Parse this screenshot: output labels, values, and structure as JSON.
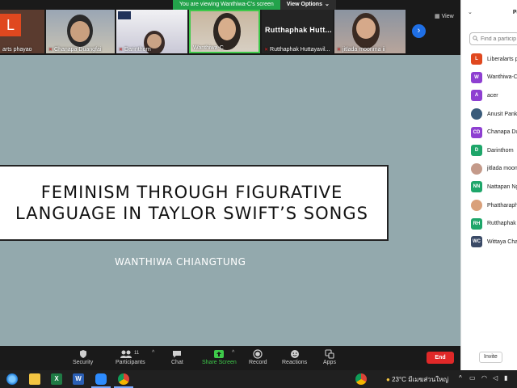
{
  "share_banner": {
    "message": "You are viewing Wanthiwa-C's screen",
    "options_label": "View Options"
  },
  "video_strip": {
    "tiles": [
      {
        "name": "arts phayao",
        "initial": "L",
        "muted": false
      },
      {
        "name": "Chanapa Duangfai",
        "muted": true
      },
      {
        "name": "Darinthorn",
        "muted": true
      },
      {
        "name": "Wanthiwa-C",
        "muted": false
      },
      {
        "name": "Rutthaphak Huttayavil...",
        "display_name": "Rutthaphak Hutt...",
        "muted": true
      },
      {
        "name": "jitlada moonma ii",
        "muted": true
      }
    ],
    "view_label": "View"
  },
  "slide": {
    "title_line1": "FEMINISM THROUGH FIGURATIVE",
    "title_line2": "LANGUAGE IN TAYLOR SWIFT’S SONGS",
    "author": "WANTHIWA CHIANGTUNG"
  },
  "toolbar": {
    "security": "Security",
    "participants": "Participants",
    "participants_count": "11",
    "chat": "Chat",
    "share_screen": "Share Screen",
    "record": "Record",
    "reactions": "Reactions",
    "apps": "Apps",
    "end": "End"
  },
  "panel": {
    "title": "Pa",
    "search_placeholder": "Find a particip",
    "participants": [
      {
        "initials": "L",
        "name": "Liberalarts p",
        "color": "#e0481f",
        "photo": false
      },
      {
        "initials": "W",
        "name": "Wanthiwa-C",
        "color": "#8e3fd1",
        "photo": false
      },
      {
        "initials": "A",
        "name": "acer",
        "color": "#8e3fd1",
        "photo": false
      },
      {
        "initials": "",
        "name": "Anusit Pankl",
        "color": "#3a5b7a",
        "photo": true
      },
      {
        "initials": "CD",
        "name": "Chanapa Du",
        "color": "#8e3fd1",
        "photo": false
      },
      {
        "initials": "D",
        "name": "Darinthorn",
        "color": "#1ea66a",
        "photo": false
      },
      {
        "initials": "",
        "name": "jitlada moon",
        "color": "#c49a8a",
        "photo": true
      },
      {
        "initials": "NN",
        "name": "Nattapan Ng",
        "color": "#1ea66a",
        "photo": false
      },
      {
        "initials": "",
        "name": "Phattharaph",
        "color": "#d9a07a",
        "photo": true
      },
      {
        "initials": "RH",
        "name": "Rutthaphak",
        "color": "#1ea66a",
        "photo": false
      },
      {
        "initials": "WC",
        "name": "Wittaya Cha",
        "color": "#3a4a66",
        "photo": false
      }
    ],
    "invite": "Invite"
  },
  "taskbar": {
    "temperature": "23°C",
    "weather": "มีเมฆส่วนใหญ่"
  },
  "colors": {
    "slide_bg": "#93a9ad",
    "accent_green": "#3ec94a",
    "end_red": "#e02828",
    "zoom_blue": "#1f6fe5"
  }
}
